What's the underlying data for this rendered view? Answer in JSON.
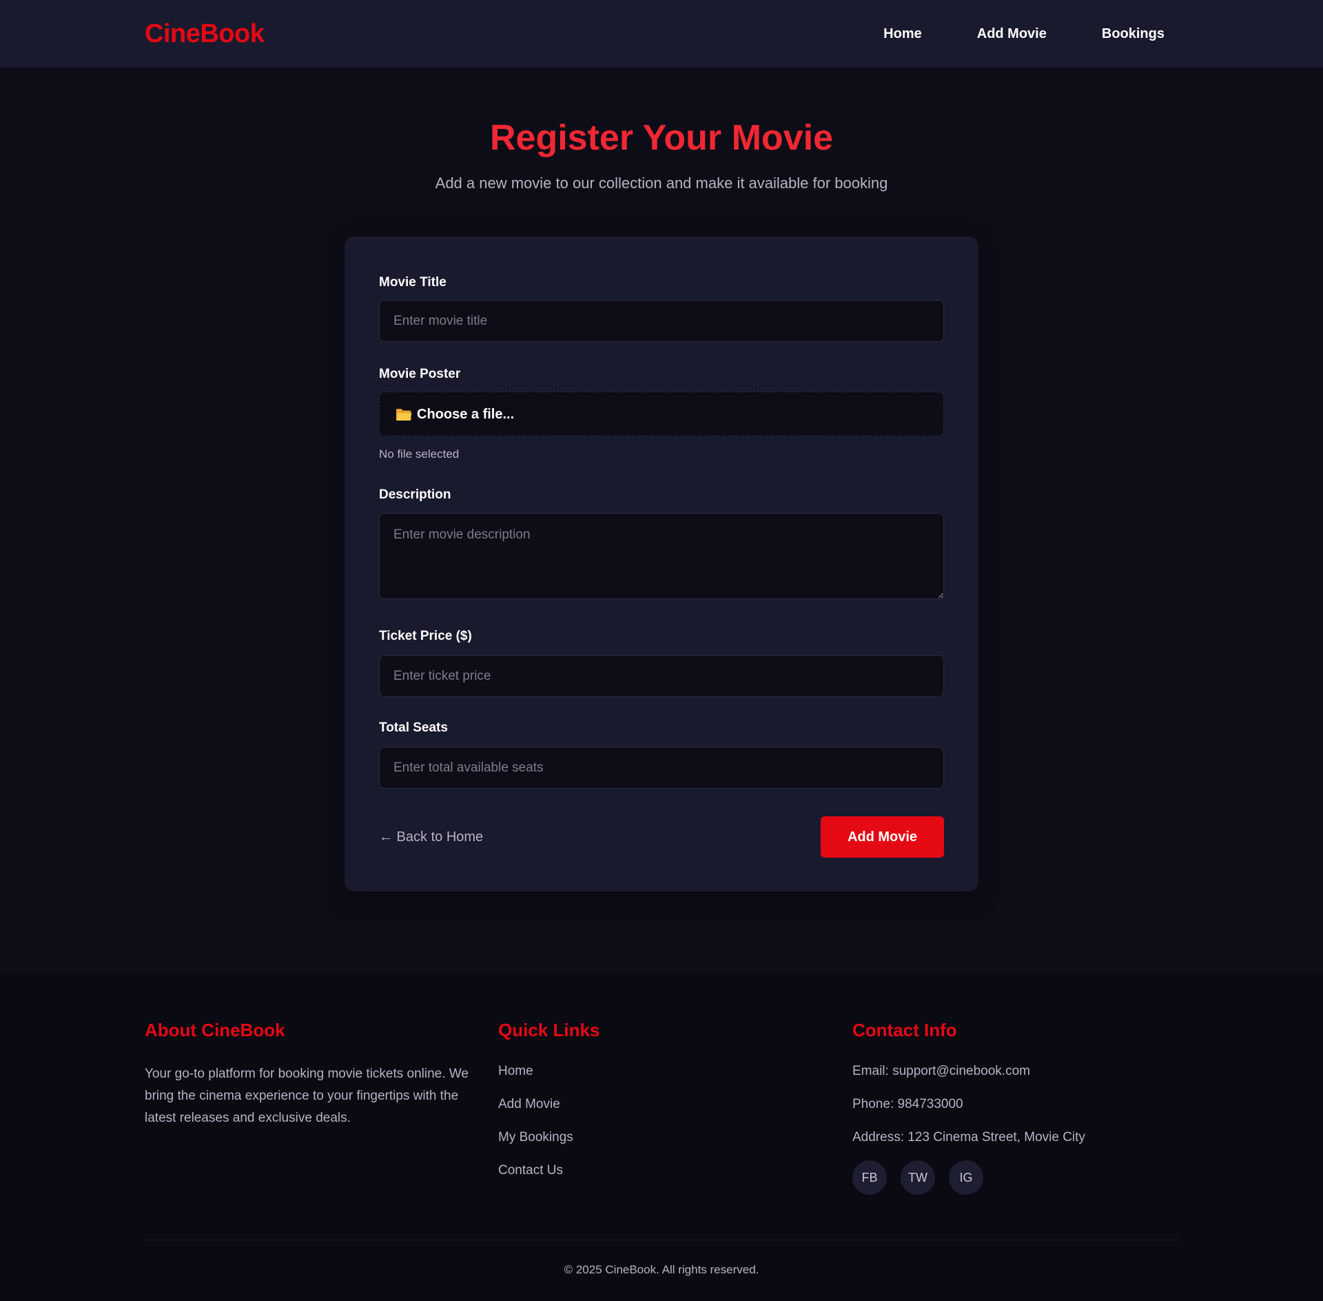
{
  "nav": {
    "logo": "CineBook",
    "links": [
      "Home",
      "Add Movie",
      "Bookings"
    ]
  },
  "hero": {
    "title": "Register Your Movie",
    "subtitle": "Add a new movie to our collection and make it available for booking"
  },
  "form": {
    "title_label": "Movie Title",
    "title_placeholder": "Enter movie title",
    "poster_label": "Movie Poster",
    "poster_icon": "folder-icon",
    "poster_button": "Choose a file...",
    "poster_status": "No file selected",
    "description_label": "Description",
    "description_placeholder": "Enter movie description",
    "price_label": "Ticket Price ($)",
    "price_placeholder": "Enter ticket price",
    "seats_label": "Total Seats",
    "seats_placeholder": "Enter total available seats",
    "back_link": "← Back to Home",
    "submit": "Add Movie"
  },
  "footer": {
    "about_heading": "About CineBook",
    "about_text": "Your go-to platform for booking movie tickets online. We bring the cinema experience to your fingertips with the latest releases and exclusive deals.",
    "links_heading": "Quick Links",
    "links": [
      "Home",
      "Add Movie",
      "My Bookings",
      "Contact Us"
    ],
    "contact_heading": "Contact Info",
    "email": "Email: support@cinebook.com",
    "phone": "Phone: 984733000",
    "address": "Address: 123 Cinema Street, Movie City",
    "social": [
      "FB",
      "TW",
      "IG"
    ],
    "copyright": "© 2025 CineBook. All rights reserved."
  },
  "colors": {
    "accent": "#e50914",
    "title_red": "#f02834",
    "page_bg": "#0d0d17",
    "card_bg": "#1a1a2e",
    "footer_bg": "#0a0a12"
  }
}
